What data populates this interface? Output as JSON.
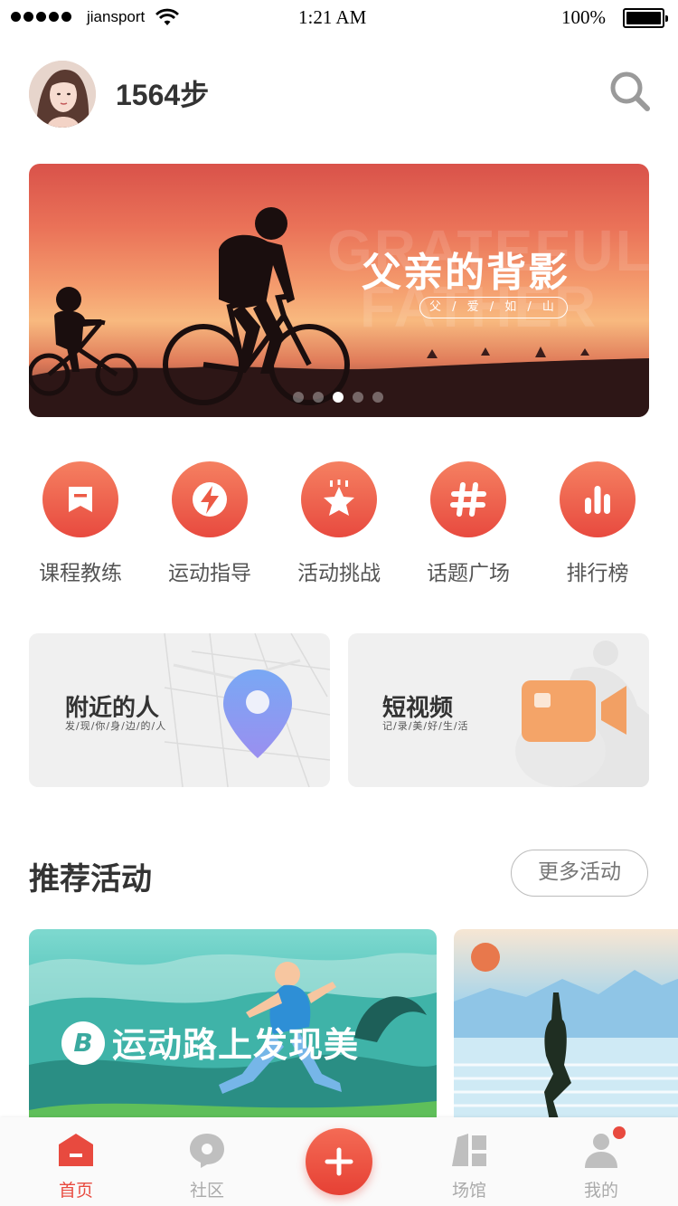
{
  "status_bar": {
    "carrier": "jiansport",
    "time": "1:21 AM",
    "battery": "100%",
    "battery_level": 1.0
  },
  "header": {
    "steps": "1564步",
    "avatar_icon": "avatar",
    "search_icon": "search-icon"
  },
  "banner": {
    "title": "父亲的背影",
    "subtitle": "父 / 爱 / 如 / 山",
    "watermark_line1": "GRATEFUL",
    "watermark_line2": "FATHER",
    "page_count": 5,
    "active_page": 3
  },
  "menu": [
    {
      "label": "课程教练",
      "icon": "bookmark-icon"
    },
    {
      "label": "运动指导",
      "icon": "lightning-icon"
    },
    {
      "label": "活动挑战",
      "icon": "star-icon"
    },
    {
      "label": "话题广场",
      "icon": "hashtag-icon"
    },
    {
      "label": "排行榜",
      "icon": "bar-chart-icon"
    }
  ],
  "cards": {
    "nearby": {
      "title": "附近的人",
      "subtitle": "发/现/你/身/边/的/人",
      "icon": "location-pin-icon"
    },
    "video": {
      "title": "短视频",
      "subtitle": "记/录/美/好/生/活",
      "icon": "video-camera-icon"
    }
  },
  "section": {
    "title": "推荐活动",
    "more": "更多活动"
  },
  "activities": [
    {
      "title": "运动路上发现美",
      "logo": "B"
    },
    {
      "title": ""
    }
  ],
  "tabbar": {
    "tabs": [
      {
        "label": "首页",
        "icon": "home-icon",
        "active": true
      },
      {
        "label": "社区",
        "icon": "chat-bubble-icon",
        "active": false
      },
      {
        "label": "",
        "icon": "plus-icon",
        "active": false
      },
      {
        "label": "场馆",
        "icon": "building-icon",
        "active": false
      },
      {
        "label": "我的",
        "icon": "user-icon",
        "active": false
      }
    ]
  },
  "colors": {
    "accent": "#e84a3f",
    "accent_light": "#f58061",
    "text": "#333333",
    "muted": "#aaaaaa"
  }
}
